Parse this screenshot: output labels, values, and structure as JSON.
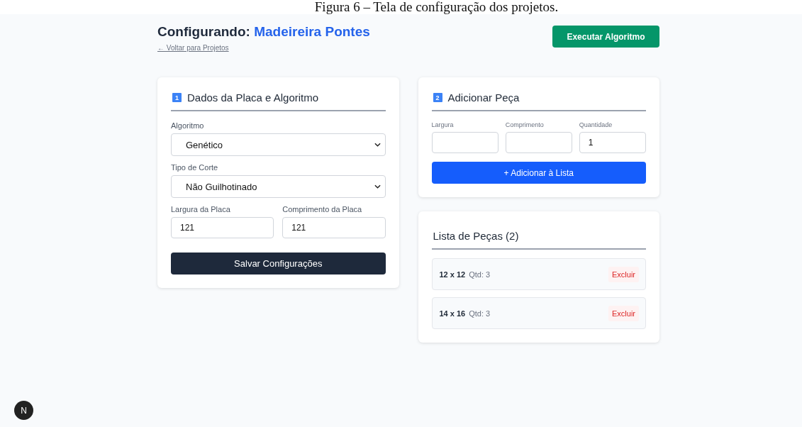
{
  "caption": "Figura 6 – Tela de configuração dos projetos.",
  "header": {
    "title_prefix": "Configurando:",
    "project_name": "Madeireira Pontes",
    "back_link": "← Voltar para Projetos",
    "run_button": "Executar Algoritmo"
  },
  "settings_panel": {
    "step": "1",
    "title": "Dados da Placa e Algoritmo",
    "fields": [
      {
        "kind": "select",
        "label": "Algoritmo",
        "value": "Genético"
      },
      {
        "kind": "select",
        "label": "Tipo de Corte",
        "value": "Não Guilhotinado"
      },
      {
        "kind": "input",
        "label": "Largura da Placa",
        "value": "121"
      },
      {
        "kind": "input",
        "label": "Comprimento da Placa",
        "value": "121"
      }
    ],
    "save_button": "Salvar Configurações"
  },
  "add_panel": {
    "step": "2",
    "title": "Adicionar Peça",
    "fields": [
      {
        "label": "Largura"
      },
      {
        "label": "Comprimento"
      },
      {
        "label": "Quantidade",
        "value": "1"
      }
    ],
    "add_button": "+ Adicionar à Lista"
  },
  "list_panel": {
    "title": "Lista de Peças (2)",
    "items": [
      {
        "size": "12 x 12",
        "quantity": "Qtd: 3",
        "delete_button": "Excluir"
      },
      {
        "size": "14 x 16",
        "quantity": "Qtd: 3",
        "delete_button": "Excluir"
      }
    ]
  },
  "dev_badge": "N"
}
